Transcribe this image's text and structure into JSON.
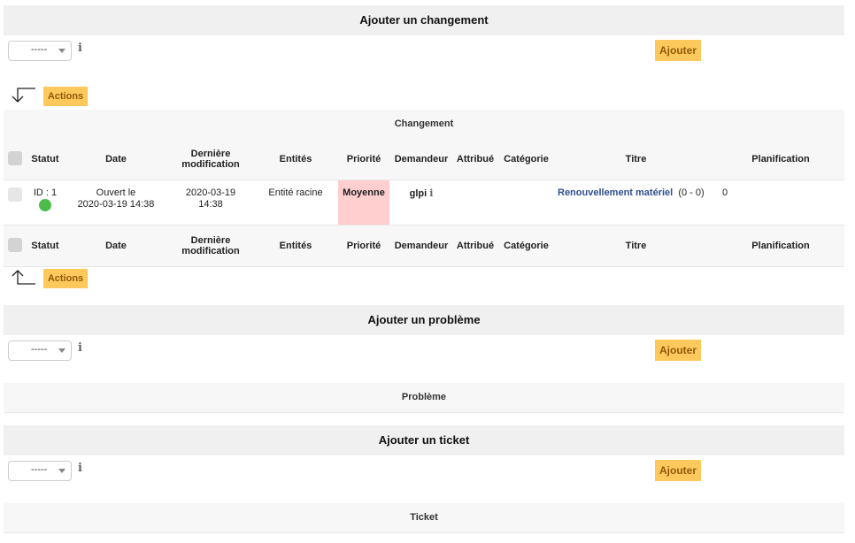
{
  "change_section": {
    "title": "Ajouter un changement",
    "select_value": "-----",
    "add_label": "Ajouter",
    "actions_label": "Actions",
    "list_title": "Changement"
  },
  "columns": [
    "Statut",
    "Date",
    "Dernière modification",
    "Entités",
    "Priorité",
    "Demandeur",
    "Attribué",
    "Catégorie",
    "Titre",
    "Planification"
  ],
  "rows": [
    {
      "id": "ID : 1",
      "status_color": "#4cbb4c",
      "date_line1": "Ouvert le",
      "date_line2": "2020-03-19 14:38",
      "modified_line1": "2020-03-19",
      "modified_line2": "14:38",
      "entity": "Entité racine",
      "priority": "Moyenne",
      "priority_color": "#ffcece",
      "requester": "glpi",
      "assigned": "",
      "category": "",
      "title": "Renouvellement matériel",
      "title_counts": "(0 - 0)",
      "planning": "0"
    }
  ],
  "problem_section": {
    "title": "Ajouter un problème",
    "select_value": "-----",
    "add_label": "Ajouter",
    "list_title": "Problème"
  },
  "ticket_section": {
    "title": "Ajouter un ticket",
    "select_value": "-----",
    "add_label": "Ajouter",
    "list_title": "Ticket"
  },
  "colors": {
    "button": "#fec95c",
    "header": "#f0f0f0",
    "link": "#2f4f8f"
  }
}
